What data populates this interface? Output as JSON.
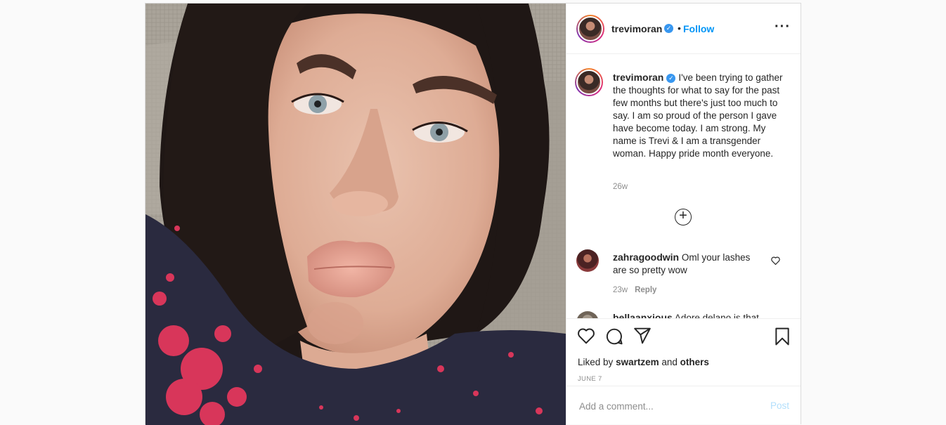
{
  "post": {
    "username": "trevimoran",
    "dot": "•",
    "follow_label": "Follow",
    "more_icon": "more-options-icon",
    "caption": "I've been trying to gather the thoughts for what to say for the past few months but there's just too much to say. I am so proud of the person I gave have become today. I am strong. My name is Trevi & I am a transgender woman. Happy pride month everyone.",
    "caption_time": "26w",
    "likes_prefix": "Liked by",
    "likes_user": "swartzem",
    "likes_and": "and",
    "likes_others": "others",
    "date": "JUNE 7"
  },
  "comments": [
    {
      "username": "zahragoodwin",
      "text": "Oml your lashes are so pretty wow",
      "time": "23w",
      "reply_label": "Reply"
    },
    {
      "username": "bellaanxious",
      "text": "Adore delano is that"
    }
  ],
  "add_comment": {
    "placeholder": "Add a comment...",
    "post_label": "Post"
  },
  "colors": {
    "accent": "#0095f6",
    "verified": "#3897f0",
    "post_disabled": "#b2dffc"
  }
}
